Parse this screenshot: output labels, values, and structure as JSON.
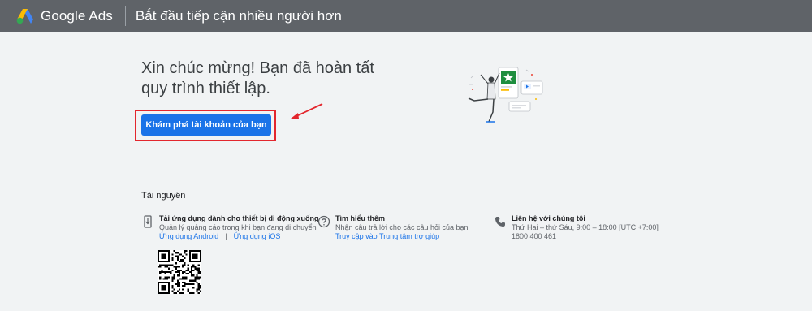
{
  "header": {
    "brand": "Google Ads",
    "page_title": "Bắt đầu tiếp cận nhiều người hơn"
  },
  "main": {
    "headline_line1": "Xin chúc mừng! Bạn đã hoàn tất",
    "headline_line2": "quy trình thiết lập.",
    "cta_label": "Khám phá tài khoản của bạn"
  },
  "resources": {
    "title": "Tài nguyên",
    "mobile": {
      "heading": "Tải ứng dụng dành cho thiết bị di động xuống",
      "description": "Quản lý quảng cáo trong khi bạn đang di chuyển",
      "android_link": "Ứng dụng Android",
      "separator": "|",
      "ios_link": "Ứng dụng iOS"
    },
    "learn": {
      "heading": "Tìm hiểu thêm",
      "description": "Nhận câu trả lời cho các câu hỏi của bạn",
      "link": "Truy cập vào Trung tâm trợ giúp"
    },
    "contact": {
      "heading": "Liên hệ với chúng tôi",
      "hours": "Thứ Hai – thứ Sáu, 9:00 – 18:00 [UTC +7:00]",
      "phone": "1800 400 461"
    }
  },
  "colors": {
    "topbar": "#5f6368",
    "primary": "#1a73e8",
    "annotation": "#e3262d"
  },
  "icons": {
    "logo": "google-ads-logo",
    "mobile": "phone-download-icon",
    "help": "help-circle-icon",
    "phone": "phone-icon"
  }
}
